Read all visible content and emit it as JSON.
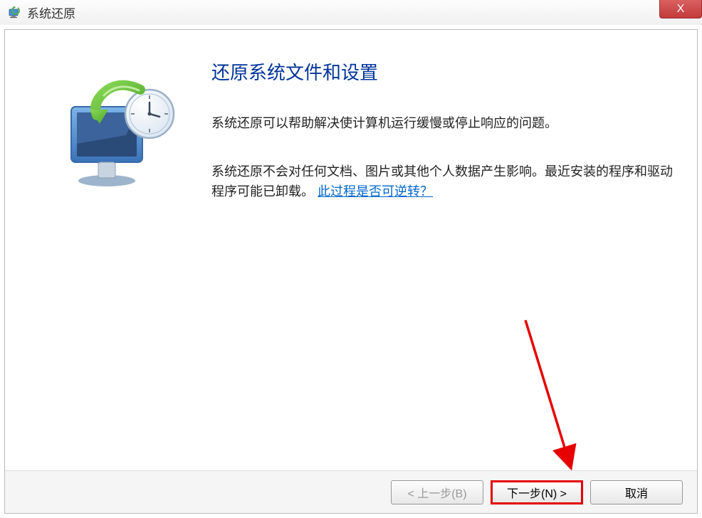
{
  "titlebar": {
    "title": "系统还原",
    "close_label": "X"
  },
  "content": {
    "heading": "还原系统文件和设置",
    "paragraph1": "系统还原可以帮助解决使计算机运行缓慢或停止响应的问题。",
    "paragraph2_part1": "系统还原不会对任何文档、图片或其他个人数据产生影响。最近安装的程序和驱动程序可能已卸载。",
    "link_text": "此过程是否可逆转？"
  },
  "buttons": {
    "back": "< 上一步(B)",
    "next": "下一步(N) >",
    "cancel": "取消"
  },
  "icons": {
    "app": "system-restore-icon",
    "illustration": "monitor-clock-restore-icon"
  },
  "colors": {
    "heading": "#003399",
    "link": "#0066cc",
    "annotation": "#e60000"
  }
}
